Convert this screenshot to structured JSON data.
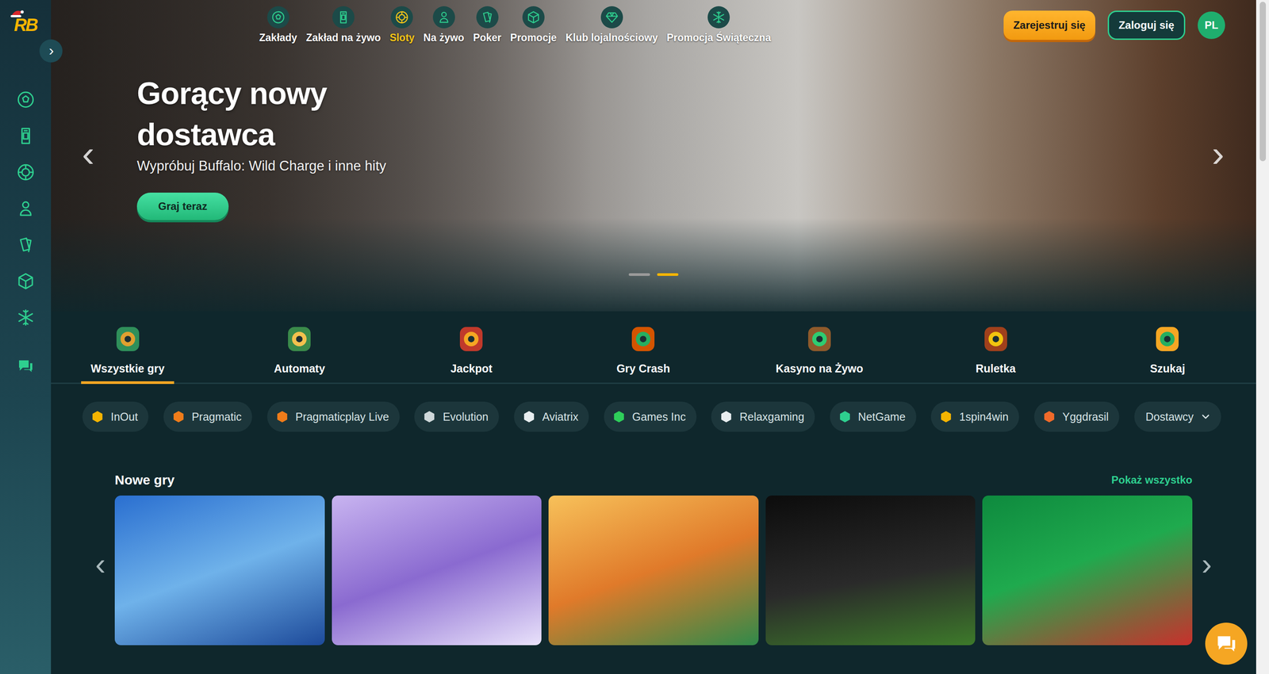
{
  "sidebar": {
    "logo": "RB",
    "toggle": "›"
  },
  "nav": [
    {
      "label": "Zakłady",
      "selected": false
    },
    {
      "label": "Zakład na żywo",
      "selected": false
    },
    {
      "label": "Sloty",
      "selected": true
    },
    {
      "label": "Na żywo",
      "selected": false
    },
    {
      "label": "Poker",
      "selected": false
    },
    {
      "label": "Promocje",
      "selected": false
    },
    {
      "label": "Klub lojalnościowy",
      "selected": false
    },
    {
      "label": "Promocja Świąteczna",
      "selected": false
    }
  ],
  "auth": {
    "register": "Zarejestruj się",
    "login": "Zaloguj się",
    "language": "PL"
  },
  "hero": {
    "title": "Gorący nowy dostawca",
    "subtitle": "Wypróbuj Buffalo: Wild Charge i inne hity",
    "button": "Graj teraz",
    "prev": "‹",
    "next": "›",
    "slides": [
      {
        "selected": false
      },
      {
        "selected": true
      }
    ]
  },
  "categories": [
    {
      "label": "Wszystkie gry",
      "selected": true
    },
    {
      "label": "Automaty",
      "selected": false
    },
    {
      "label": "Jackpot",
      "selected": false
    },
    {
      "label": "Gry Crash",
      "selected": false
    },
    {
      "label": "Kasyno na Żywo",
      "selected": false
    },
    {
      "label": "Ruletka",
      "selected": false
    },
    {
      "label": "Szukaj",
      "selected": false
    }
  ],
  "providers": [
    "InOut",
    "Pragmatic",
    "Pragmaticplay Live",
    "Evolution",
    "Aviatrix",
    "Games Inc",
    "Relaxgaming",
    "NetGame",
    "1spin4win",
    "Yggdrasil"
  ],
  "providers_dropdown": "Dostawcy",
  "new_games": {
    "title": "Nowe gry",
    "show_all": "Pokaż wszystko",
    "prev": "‹",
    "next": "›",
    "games": [
      {
        "kind": "thumbnail"
      },
      {
        "kind": "thumbnail"
      },
      {
        "kind": "thumbnail"
      },
      {
        "kind": "thumbnail"
      },
      {
        "kind": "thumbnail"
      }
    ]
  }
}
